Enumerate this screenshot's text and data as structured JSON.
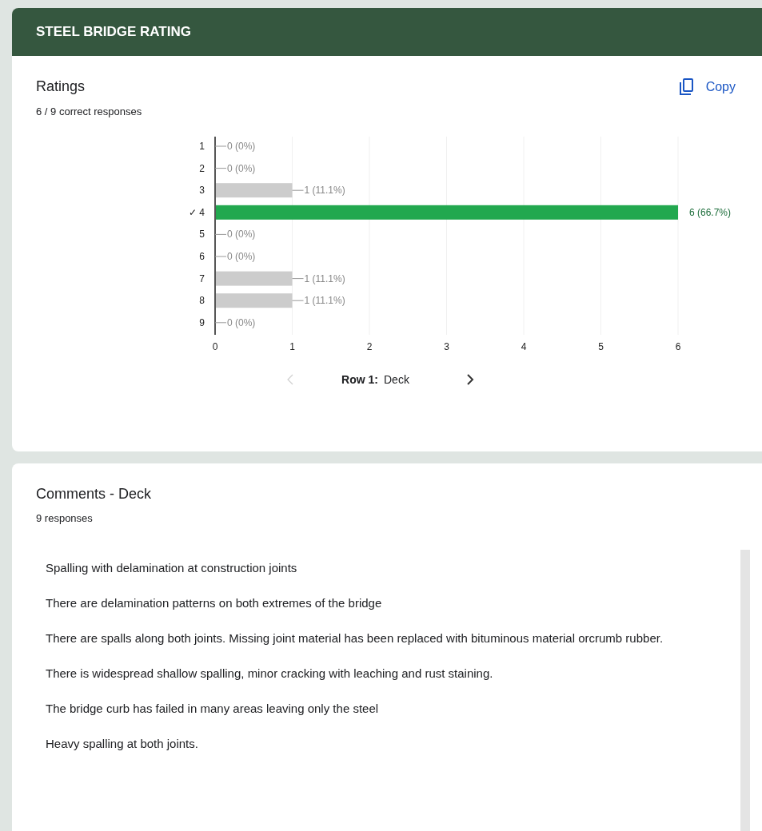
{
  "header": {
    "title": "STEEL BRIDGE RATING"
  },
  "ratings": {
    "title": "Ratings",
    "subtitle": "6 / 9 correct responses",
    "copy_label": "Copy",
    "chart_data": {
      "type": "bar",
      "orientation": "horizontal",
      "grid": true,
      "categories": [
        "1",
        "2",
        "3",
        "✓ 4",
        "5",
        "6",
        "7",
        "8",
        "9"
      ],
      "series": [
        {
          "color": "#cccccc",
          "values": [
            0,
            0,
            1,
            null,
            0,
            0,
            1,
            1,
            0
          ]
        },
        {
          "color": "#22a84f",
          "values": [
            null,
            null,
            null,
            6,
            null,
            null,
            null,
            null,
            null
          ]
        }
      ],
      "xlim": [
        0,
        6
      ],
      "xticks": [
        0,
        1,
        2,
        3,
        4,
        5,
        6
      ],
      "value_labels": [
        "0 (0%)",
        "0 (0%)",
        "1 (11.1%)",
        "6 (66.7%)",
        "0 (0%)",
        "0 (0%)",
        "1 (11.1%)",
        "1 (11.1%)",
        "0 (0%)"
      ],
      "title": null
    },
    "nav": {
      "prev": {
        "disabled": true
      },
      "row_label": "Row 1:",
      "row_name": "Deck",
      "next": {
        "disabled": false
      }
    }
  },
  "comments": {
    "title": "Comments - Deck",
    "subtitle": "9 responses",
    "responses": [
      "Spalling with delamination at construction joints",
      "There are delamination patterns on both extremes of the bridge",
      "There are spalls along both joints. Missing joint material has been replaced with bituminous material orcrumb rubber.",
      "There is widespread shallow spalling, minor cracking with leaching and rust staining.",
      "The bridge curb has failed in many areas leaving only the steel",
      "Heavy spalling at both joints."
    ]
  }
}
